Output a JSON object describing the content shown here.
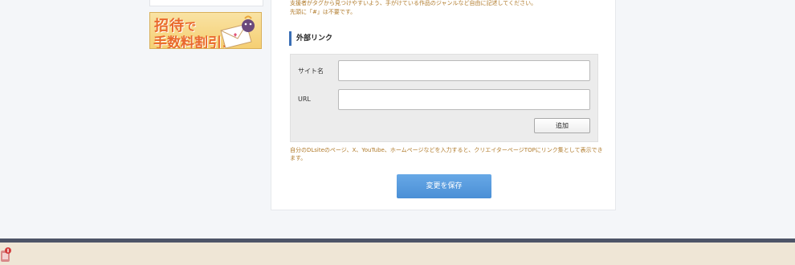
{
  "sidebar": {
    "banner": {
      "line1": "招待",
      "line1_suffix": "で",
      "line2": "手数料割引!"
    }
  },
  "main": {
    "hint_line1": "支援者がタグから見つけやすいよう、手がけている作品のジャンルなど自由に記述してください。",
    "hint_line2": "先頭に「#」は不要です。",
    "section_title": "外部リンク",
    "fields": {
      "site_name_label": "サイト名",
      "site_name_value": "",
      "url_label": "URL",
      "url_value": ""
    },
    "add_button": "追加",
    "note": "自分のDLsiteのページ、X、YouTube、ホームページなどを入力すると、クリエイターページTOPにリンク集として表示できます。",
    "save_button": "変更を保存"
  },
  "colors": {
    "accent": "#3b6fb5",
    "save_button": "#4a8fd6",
    "hint_text": "#b07a2a",
    "footer_bar": "#4d5467",
    "footer_bg": "#efe6d6"
  }
}
